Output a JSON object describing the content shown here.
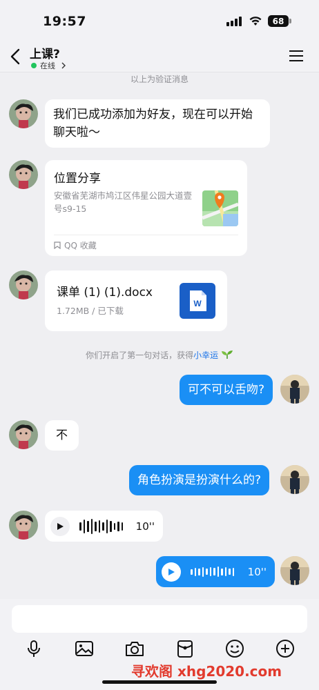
{
  "status": {
    "time": "19:57",
    "battery": "68"
  },
  "header": {
    "title": "上课?",
    "online_label": "在线"
  },
  "notes": {
    "verify": "以上为验证消息",
    "first_chat_prefix": "你们开启了第一句对话，获得",
    "first_chat_link": "小幸运"
  },
  "messages": {
    "m1": "我们已成功添加为好友，现在可以开始聊天啦～",
    "location": {
      "title": "位置分享",
      "address": "安徽省芜湖市鸠江区伟星公园大道壹号s9-15",
      "footer": "QQ 收藏"
    },
    "file": {
      "name": "课单 (1) (1).docx",
      "meta": "1.72MB / 已下载",
      "icon_letter": "W"
    },
    "m_me1": "可不可以舌吻?",
    "m_other2": "不",
    "m_me2": "角色扮演是扮演什么的?",
    "voice_other": {
      "duration": "10''"
    },
    "voice_me": {
      "duration": "10''"
    }
  },
  "watermark": "寻欢阁 xhg2020.com",
  "colors": {
    "accent": "#1a8ff5",
    "online": "#22c55e",
    "watermark": "#e23b2e"
  }
}
